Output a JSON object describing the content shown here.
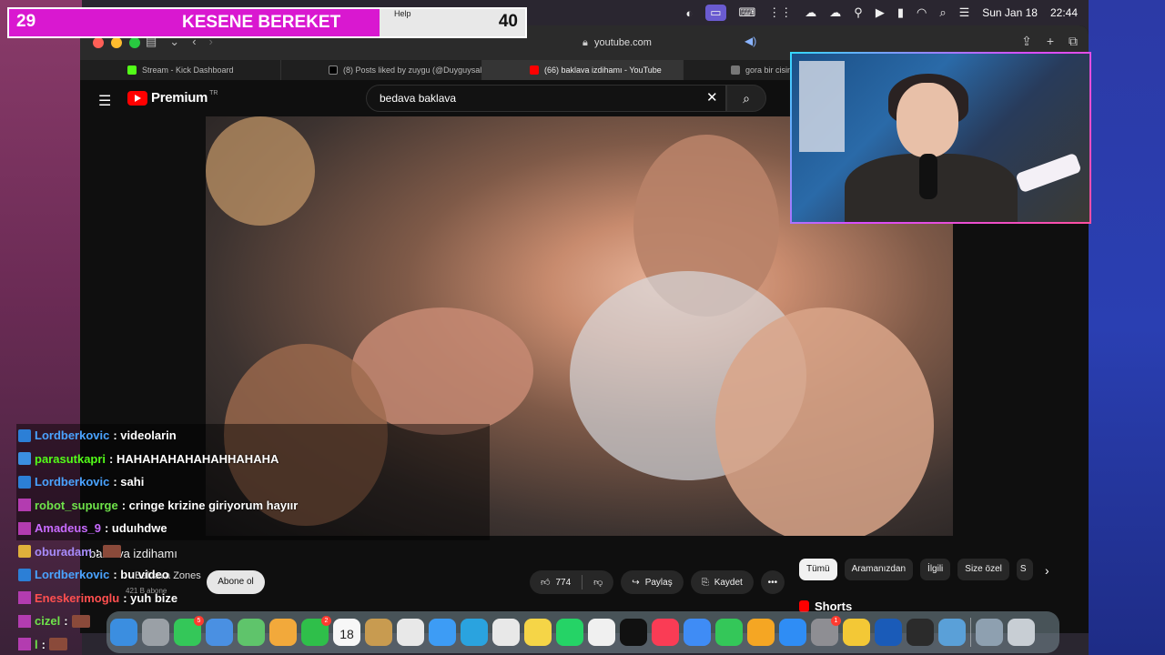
{
  "menubar": {
    "date": "Sun Jan 18",
    "time": "22:44"
  },
  "browser": {
    "url": "youtube.com",
    "tabs": [
      {
        "title": "Stream - Kick Dashboard",
        "favicon": "kick-logo-icon"
      },
      {
        "title": "(8) Posts liked by zuygu (@Duyguysal1) / X",
        "favicon": "x-logo-icon"
      },
      {
        "title": "(66) baklava izdihamı - YouTube",
        "favicon": "youtube-logo-icon",
        "active": true
      },
      {
        "title": "gora bir cisim",
        "favicon": "google-logo-icon"
      }
    ]
  },
  "youtube": {
    "brand": "Premium",
    "country": "TR",
    "search_query": "bedava baklava",
    "video_title": "baklava izdihamı",
    "channel": "Baklava Zones",
    "subscribers": "421 B abone",
    "subscribe_label": "Abone ol",
    "like_count": "774",
    "share_label": "Paylaş",
    "save_label": "Kaydet",
    "chips": [
      "Tümü",
      "Aramanızdan",
      "İlgili",
      "Size özel",
      "S"
    ],
    "shorts_label": "Shorts"
  },
  "overlay": {
    "left_count": "29",
    "title": "KESENE BEREKET",
    "help": "Help",
    "right_count": "40"
  },
  "chat": [
    {
      "badge": "x",
      "user": "Lordberkovic",
      "color": "#4aa3ff",
      "msg": ": videolarin"
    },
    {
      "badge": "kick",
      "user": "parasutkapri",
      "color": "#53fc18",
      "msg": ": HAHAHAHAHAHAHHAHAHA"
    },
    {
      "badge": "x",
      "user": "Lordberkovic",
      "color": "#4aa3ff",
      "msg": ": sahi"
    },
    {
      "badge": "z",
      "user": "robot_supurge",
      "color": "#6fe34a",
      "msg": ": cringe krizine giriyorum hayıır"
    },
    {
      "badge": "z",
      "user": "Amadeus_9",
      "color": "#c86bff",
      "msg": ": uduıhdwe"
    },
    {
      "badge": "g",
      "user": "oburadam",
      "color": "#a78bfa",
      "msg": ":"
    },
    {
      "badge": "x",
      "user": "Lordberkovic",
      "color": "#4aa3ff",
      "msg": ": bu video"
    },
    {
      "badge": "z",
      "user": "Eneskerimoglu",
      "color": "#ff4f4f",
      "msg": ": yuh bize"
    },
    {
      "badge": "z",
      "user": "cizel",
      "color": "#6fe34a",
      "msg": ":"
    },
    {
      "badge": "z",
      "user": "l",
      "color": "#6fe34a",
      "msg": ":"
    }
  ],
  "dock": {
    "apps": [
      {
        "name": "finder-icon",
        "color": "#3b8ee0"
      },
      {
        "name": "launchpad-icon",
        "color": "#9aa0a6"
      },
      {
        "name": "messages-icon",
        "color": "#34c759",
        "badge": "5"
      },
      {
        "name": "mail-icon",
        "color": "#4a90e2"
      },
      {
        "name": "maps-icon",
        "color": "#5fc46b"
      },
      {
        "name": "photos-icon",
        "color": "#f2a93b"
      },
      {
        "name": "facetime-icon",
        "color": "#2fbf4a",
        "badge": "2"
      },
      {
        "name": "calendar-icon",
        "color": "#f7f7f7",
        "label": "18"
      },
      {
        "name": "notes-icon",
        "color": "#c89b50"
      },
      {
        "name": "reminders-icon",
        "color": "#e8e8e8"
      },
      {
        "name": "safari-icon",
        "color": "#3d9cf5"
      },
      {
        "name": "telegram-icon",
        "color": "#2aa3df"
      },
      {
        "name": "chrome-icon",
        "color": "#e8e8e8"
      },
      {
        "name": "notes-yellow-icon",
        "color": "#f5d547"
      },
      {
        "name": "whatsapp-icon",
        "color": "#25d366"
      },
      {
        "name": "freeform-icon",
        "color": "#f0f0f0"
      },
      {
        "name": "apple-tv-icon",
        "color": "#111111"
      },
      {
        "name": "music-icon",
        "color": "#fa3c55"
      },
      {
        "name": "keynote-icon",
        "color": "#3f8cf5"
      },
      {
        "name": "numbers-icon",
        "color": "#34c759"
      },
      {
        "name": "pages-icon",
        "color": "#f5a623"
      },
      {
        "name": "app-store-icon",
        "color": "#2f8df5"
      },
      {
        "name": "system-settings-icon",
        "color": "#8e8e93",
        "badge": "1"
      },
      {
        "name": "python-launcher-icon",
        "color": "#f3c836"
      },
      {
        "name": "wd-icon",
        "color": "#1a5bb8"
      },
      {
        "name": "obs-icon",
        "color": "#2b2b2b"
      },
      {
        "name": "quicktime-icon",
        "color": "#5aa0d8"
      },
      {
        "name": "downloads-folder-icon",
        "color": "#8ea0b0"
      },
      {
        "name": "trash-icon",
        "color": "#c8ced4"
      }
    ]
  }
}
